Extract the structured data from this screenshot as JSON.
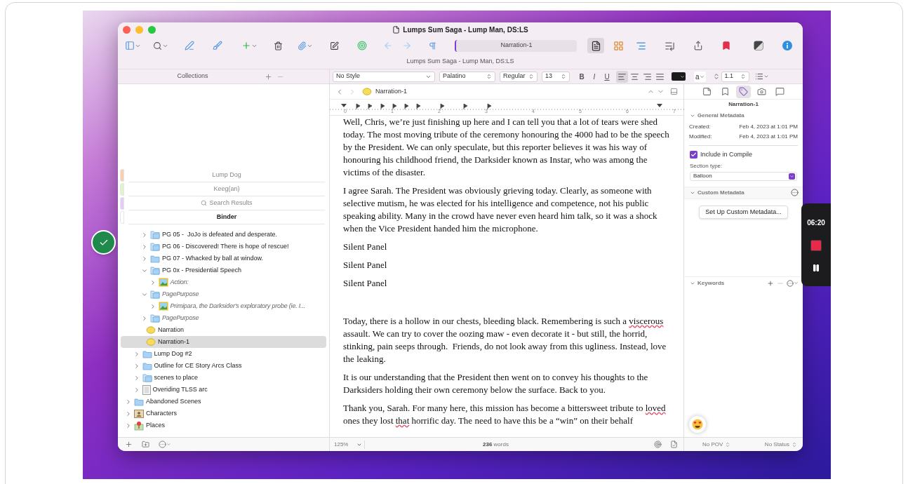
{
  "window": {
    "title": "Lumps Sum Saga - Lump Man, DS:LS",
    "subtitle": "Lumps Sum Saga - Lump Man, DS:LS"
  },
  "toolbar": {
    "title_field": "Narration-1",
    "views": [
      {
        "kind": "document",
        "selected": true
      },
      {
        "kind": "corkboard",
        "selected": false
      },
      {
        "kind": "outline",
        "selected": false
      }
    ]
  },
  "format_bar": {
    "style": "No Style",
    "font": "Palatino",
    "weight": "Regular",
    "size": "13",
    "styles": [
      "B",
      "I",
      "U"
    ],
    "alignments": [
      {
        "kind": "left",
        "selected": true
      },
      {
        "kind": "center",
        "selected": false
      },
      {
        "kind": "right",
        "selected": false
      },
      {
        "kind": "justify",
        "selected": false
      }
    ],
    "highlight": "a",
    "line_spacing": "1.1"
  },
  "collections": {
    "header": "Collections",
    "tabs": [
      {
        "label": "Lump Dog",
        "color": "#f6cfb4",
        "kind": "collection",
        "selected": false
      },
      {
        "label": "Keeg(an)",
        "color": "#e3f3cf",
        "kind": "collection",
        "selected": false
      },
      {
        "label": "Search Results",
        "color": "#e3cdf3",
        "kind": "search",
        "selected": false
      },
      {
        "label": "Binder",
        "color": "#ffffff",
        "kind": "binder",
        "selected": true
      }
    ]
  },
  "binder": {
    "tree": [
      {
        "children": [
          {
            "children": [
              {
                "label": "PG 05 -  JoJo is defeated and desperate.",
                "kind": "stack",
                "expanded": false,
                "italic": false,
                "selected": false
              },
              {
                "label": "PG 06 - Discovered! There is hope of rescue!",
                "kind": "stack",
                "expanded": false,
                "italic": false,
                "selected": false
              },
              {
                "label": "PG 07 - Whacked by ball at window.",
                "kind": "folder",
                "expanded": false,
                "italic": false,
                "selected": false
              },
              {
                "label": "PG 0x - Presidential Speech",
                "kind": "stack",
                "expanded": true,
                "italic": false,
                "selected": false,
                "children": [
                  {
                    "label": "Action:",
                    "kind": "image",
                    "expanded": false,
                    "italic": true,
                    "selected": false
                  }
                ]
              },
              {
                "label": "PagePurpose",
                "kind": "stack",
                "expanded": true,
                "italic": true,
                "selected": false,
                "children": [
                  {
                    "label": "Primipara, the Darksider's exploratory probe (ie. I...",
                    "kind": "image",
                    "expanded": false,
                    "italic": true,
                    "selected": false
                  }
                ]
              },
              {
                "label": "PagePurpose",
                "kind": "stack",
                "expanded": false,
                "italic": true,
                "selected": false
              },
              {
                "label": "Narration",
                "kind": "balloon",
                "italic": false,
                "selected": false
              },
              {
                "label": "Narration-1",
                "kind": "balloon",
                "italic": false,
                "selected": true
              }
            ]
          },
          {
            "label": "Lump Dog #2",
            "kind": "folder",
            "expanded": false,
            "italic": false,
            "selected": false
          },
          {
            "label": "Outline for CE Story Arcs Class",
            "kind": "folder",
            "expanded": false,
            "italic": false,
            "selected": false
          },
          {
            "label": "scenes to place",
            "kind": "stack",
            "expanded": false,
            "italic": false,
            "selected": false
          },
          {
            "label": "Overiding TLSS arc",
            "kind": "doc",
            "expanded": false,
            "italic": false,
            "selected": false
          }
        ]
      },
      {
        "label": "Abandoned Scenes",
        "kind": "folder",
        "expanded": false,
        "italic": false,
        "selected": false
      },
      {
        "label": "Characters",
        "kind": "characters",
        "expanded": false,
        "italic": false,
        "selected": false
      },
      {
        "label": "Places",
        "kind": "places",
        "expanded": false,
        "italic": false,
        "selected": false
      }
    ]
  },
  "editor": {
    "title": "Narration-1",
    "ruler": [
      "0",
      "1",
      "2",
      "3",
      "4",
      "5",
      "6",
      "7"
    ],
    "paragraphs": [
      {
        "segments": [
          {
            "text": "Well, Chris, we’re just finishing up here and I can tell you that a lot of tears were shed today. The most moving tribute of the ceremony honouring the 4000 had to be the speech by the President. We can only speculate, but this reporter believes it was his way of honouring his childhood friend, the Darksider known as Instar, who was among the victims of the disaster.",
            "misspelled": false
          }
        ]
      },
      {
        "segments": [
          {
            "text": "I agree Sarah. The President was obviously grieving today. Clearly, as someone with selective mutism, he was elected for his intelligence and competence, not his public speaking ability. Many in the crowd have never even heard him talk, so it was a shock when the Vice President handed him the microphone.",
            "misspelled": false
          }
        ]
      },
      {
        "segments": [
          {
            "text": "Silent Panel",
            "misspelled": false
          }
        ]
      },
      {
        "segments": [
          {
            "text": "Silent Panel",
            "misspelled": false
          }
        ]
      },
      {
        "segments": [
          {
            "text": "Silent Panel",
            "misspelled": false
          }
        ]
      },
      {
        "segments": [
          {
            "text": "Today, there is a hollow in our chests, bleeding black. Remembering is such a ",
            "misspelled": false
          },
          {
            "text": "viscerous",
            "misspelled": true
          },
          {
            "text": " assault. We can try to cover the oozing maw - even decorate it - but still, the horrid, stinking, pain seeps through.  Friends, do not look away from this ugliness. Instead, love the leaking.",
            "misspelled": false
          }
        ]
      },
      {
        "segments": [
          {
            "text": "It is our understanding that the President then went on to convey his thoughts to the Darksiders holding their own ceremony below the surface. Back to you.",
            "misspelled": false
          }
        ]
      },
      {
        "segments": [
          {
            "text": "Thank you, Sarah. For many here, this mission has become a bittersweet tribute to ",
            "misspelled": false
          },
          {
            "text": "loved",
            "misspelled": true
          },
          {
            "text": " ones they lost ",
            "misspelled": false
          },
          {
            "text": "that",
            "misspelled": true
          },
          {
            "text": " horrific day. The need to have this be a “win” on their behalf",
            "misspelled": false
          }
        ]
      }
    ]
  },
  "inspector": {
    "tabs": [
      {
        "kind": "notes",
        "selected": false
      },
      {
        "kind": "bookmarks",
        "selected": false
      },
      {
        "kind": "metadata",
        "selected": true
      },
      {
        "kind": "snapshots",
        "selected": false
      },
      {
        "kind": "comments",
        "selected": false
      }
    ],
    "title": "Narration-1",
    "general_header": "General Metadata",
    "rows": [
      {
        "label": "Created:",
        "value": "Feb 4, 2023 at 1:01 PM"
      },
      {
        "label": "Modified:",
        "value": "Feb 4, 2023 at 1:01 PM"
      }
    ],
    "include": {
      "label": "Include in Compile",
      "checked": true
    },
    "section_type_label": "Section type:",
    "section_type": "Balloon",
    "custom_header": "Custom Metadata",
    "custom_button": "Set Up Custom Metadata...",
    "keywords_header": "Keywords"
  },
  "status_bar": {
    "zoom": "125%",
    "word_count": "236",
    "word_label": "words",
    "pov": "No POV",
    "status": "No Status"
  },
  "recorder": {
    "time": "06:20"
  }
}
